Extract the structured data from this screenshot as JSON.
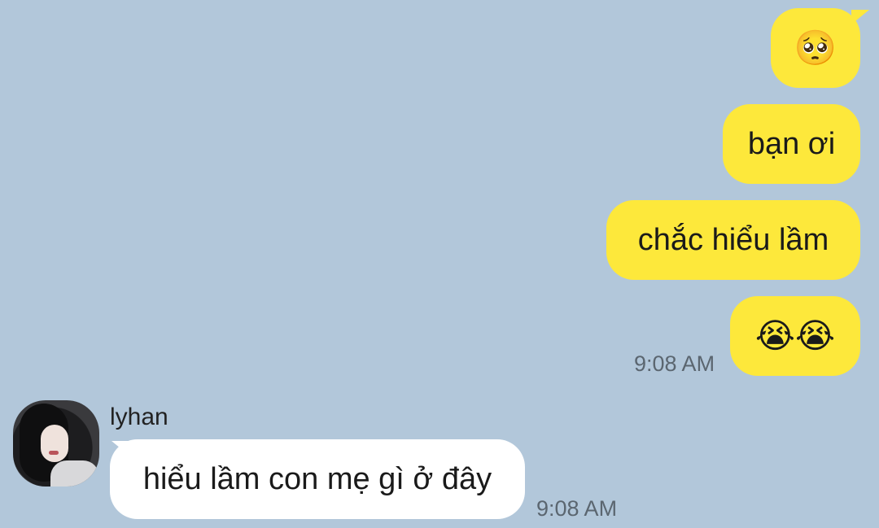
{
  "conversation": {
    "outgoing": [
      {
        "type": "emoji",
        "text": "🥺"
      },
      {
        "type": "text",
        "text": "bạn ơi"
      },
      {
        "type": "text",
        "text": "chắc hiểu lầm"
      },
      {
        "type": "emoji",
        "text": "😭😭"
      }
    ],
    "outgoing_time": "9:08 AM",
    "incoming": {
      "sender": "lyhan",
      "message": "hiểu lầm con mẹ gì ở đây",
      "time": "9:08 AM"
    }
  },
  "colors": {
    "background": "#b2c7da",
    "outgoing_bubble": "#fde83b",
    "incoming_bubble": "#ffffff",
    "timestamp": "#5b6670"
  }
}
